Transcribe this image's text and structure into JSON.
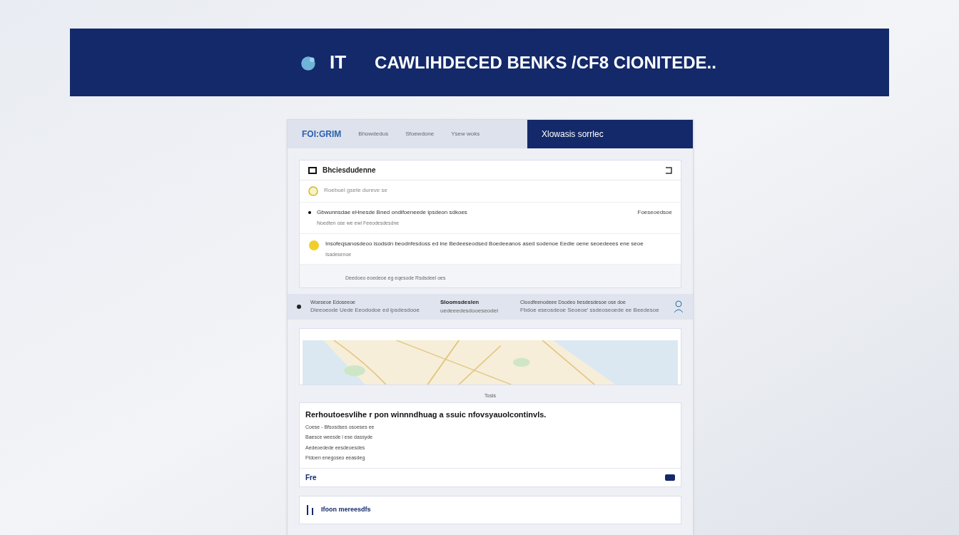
{
  "banner": {
    "short": "IT",
    "headline": "CAWLIHDECED BENKS /CF8 CIONITEDE.."
  },
  "header": {
    "brand": "FOI:GRIM",
    "links": [
      "Bhowdedus",
      "Sfoewdone",
      "Ysew woks"
    ],
    "tab": {
      "label": "Xlowasis sorrlec",
      "selected": true
    }
  },
  "feed": {
    "title": "Bhciesdudenne",
    "rows": [
      {
        "kind": "status",
        "text": "Roebuel gsete dureve se"
      },
      {
        "kind": "bullet",
        "text": "Gbwunnsdae eHnesde Bned ondifoeneede ipsdeon sdkoes",
        "meta": "Foeseoedsoe",
        "sub": "Noedten ose we ewi Feeodesdesdne"
      },
      {
        "kind": "alert",
        "text": "Insofeqsanosdeoo isodsdn beodnfesdoss ed ine Bedeeseodsed Boedeeanos ased sodenoe Eedie oene seoedeees ene seoe",
        "sub": "Isadesenoe"
      }
    ],
    "footer": "Deedoeo eoedeoe eg eqesode Rsdsdeel oes"
  },
  "strip": {
    "left_title": "Woeseoe Edoseeoe",
    "left_sub": "Dieeoeode Uede Eeododoe ed ipsdesdooe",
    "mid_title": "Sloomsdeslen",
    "mid_sub": "uedeeedesdooeseodel",
    "right_title": "Cloodfeenodeee Dsodeo besdesdesoe ose doe",
    "right_sub": "Fbdoe eseosdeoe Seoeoe' ssdeoseoede ee Beedesoe"
  },
  "map": {
    "caption": "Tosis"
  },
  "info": {
    "title": "Rerhoutoesvlihe r pon winnndhuag a ssuic nfovsyauolcontinvls.",
    "lines": [
      "Coese - Bfsosdses osoeses ee",
      "Baesce weesde i ese dassyde",
      "Aedeoedede eesdeoesdes",
      "Ftdoen enegoseo eeasdeg"
    ],
    "action": "Fre"
  },
  "next": {
    "title": "Ifoon mereesdfs"
  }
}
